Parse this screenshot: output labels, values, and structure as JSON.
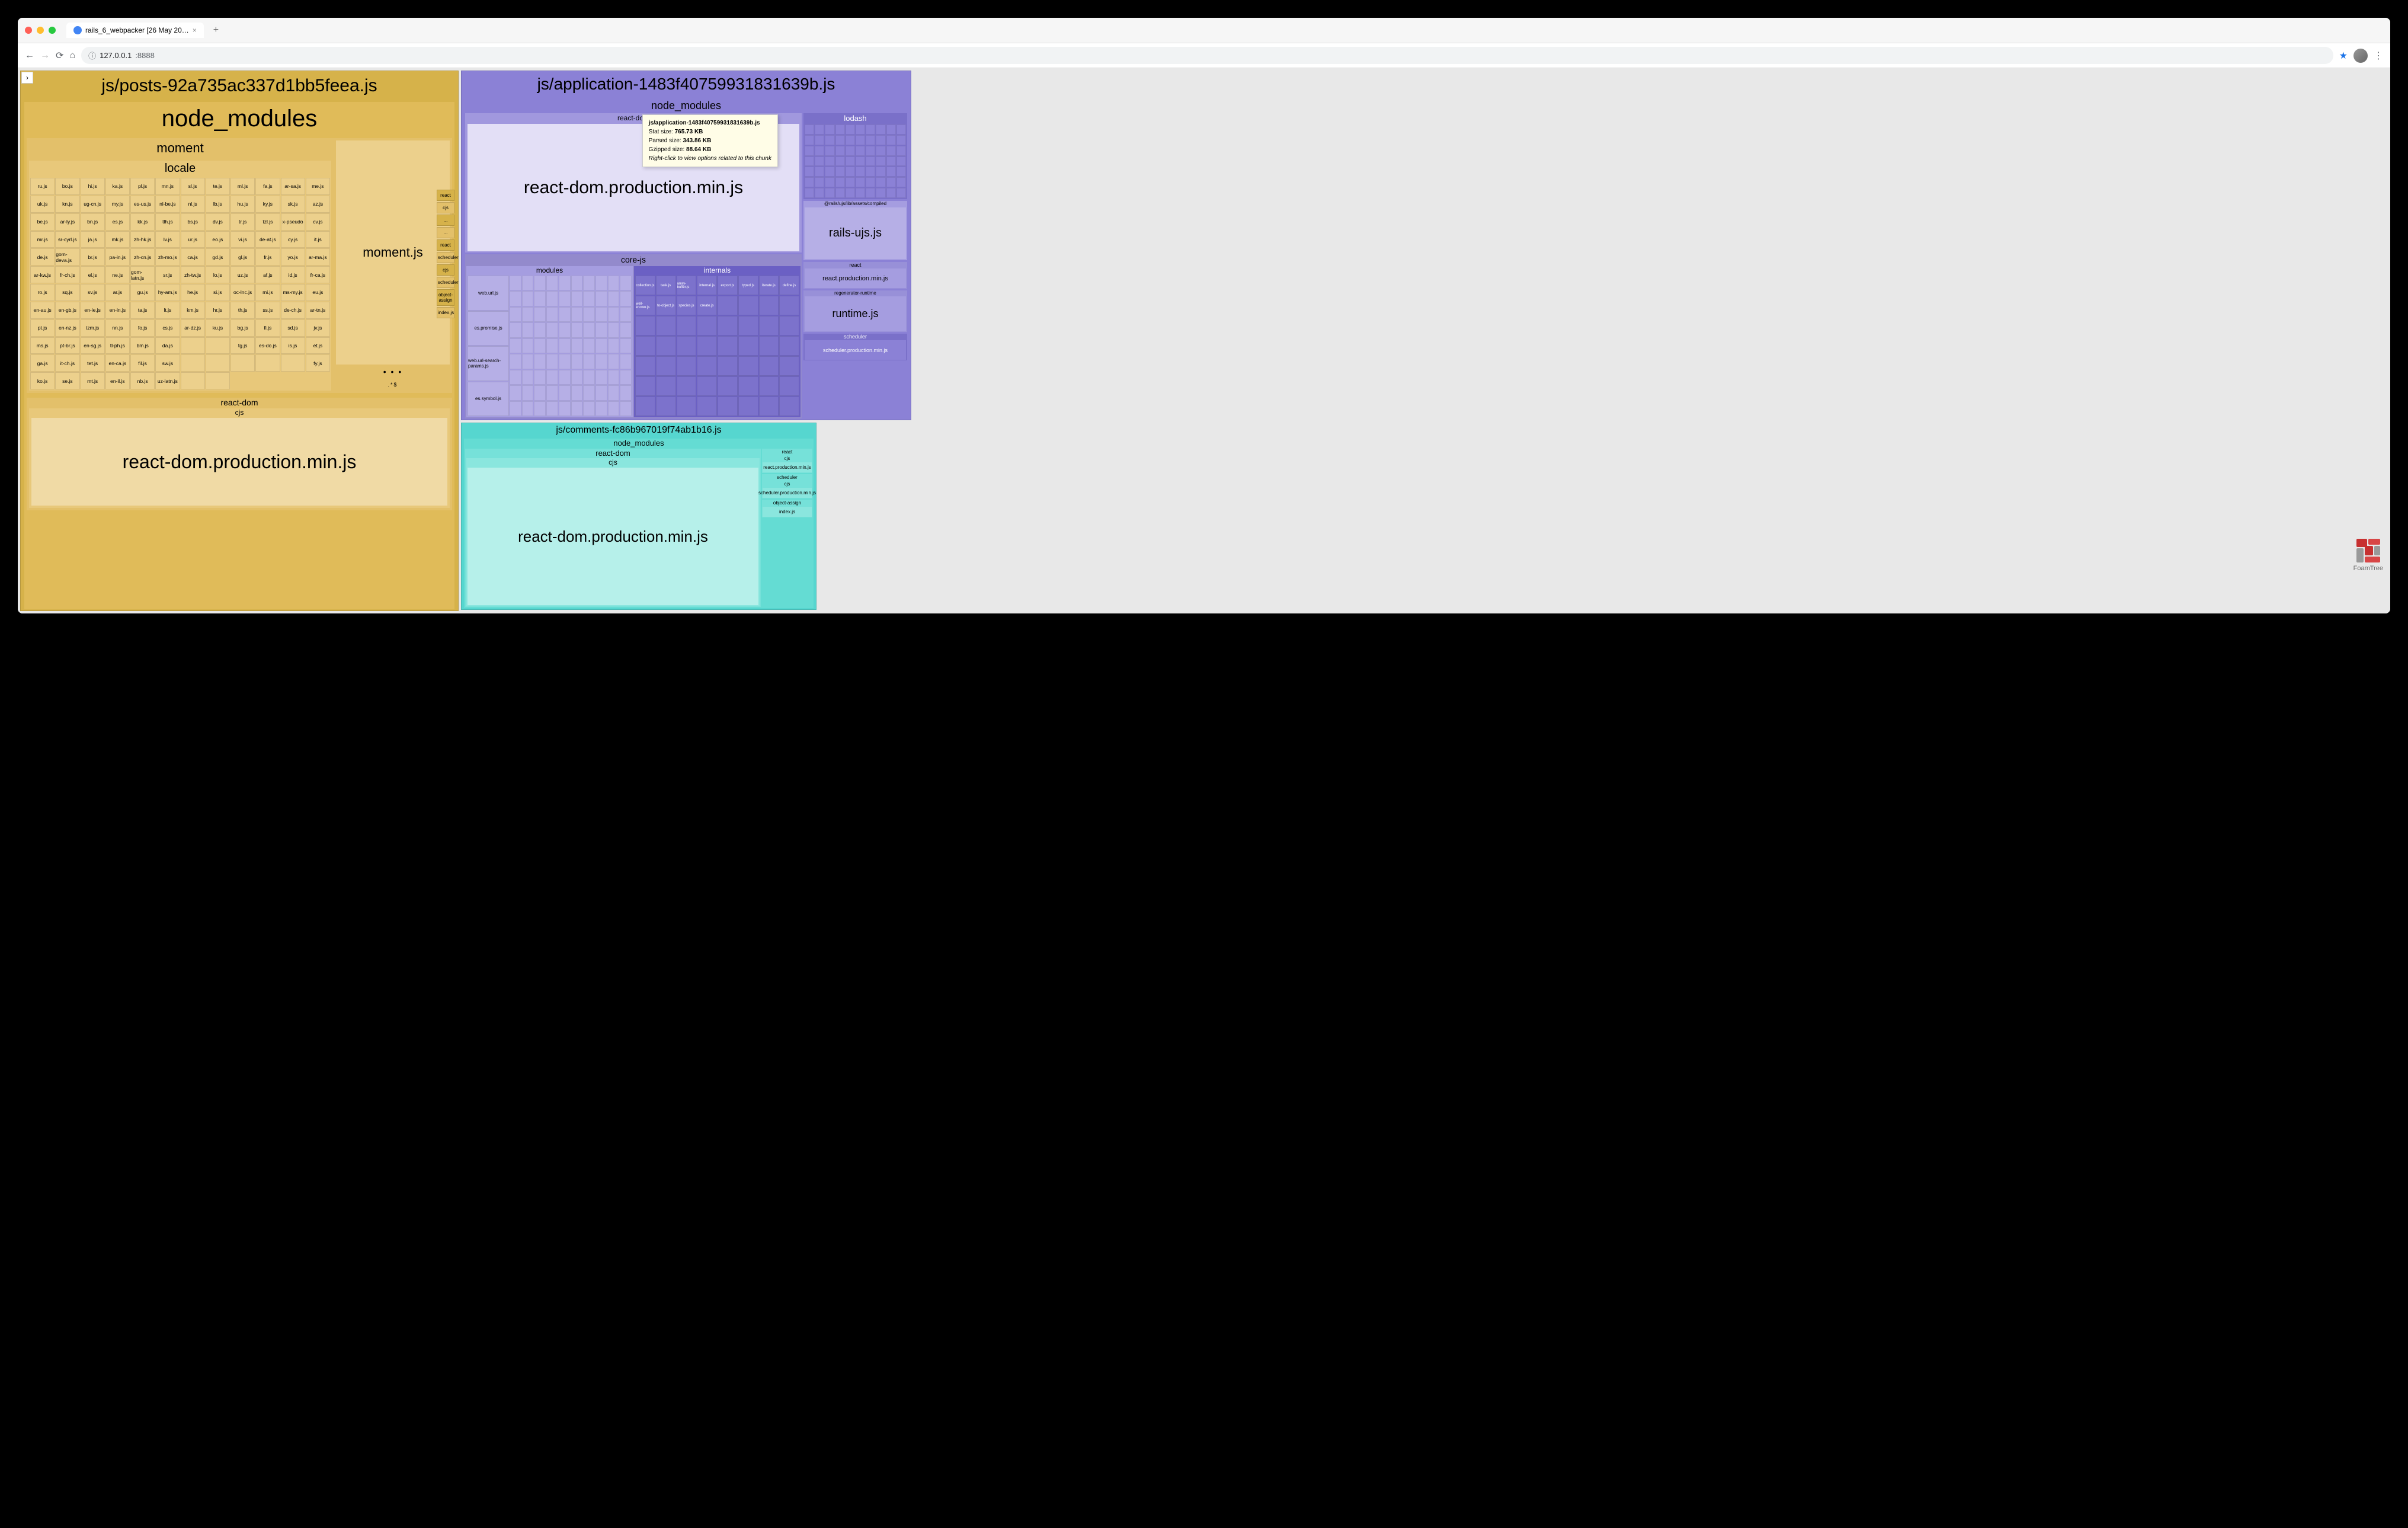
{
  "browser": {
    "tab_title": "rails_6_webpacker [26 May 20…",
    "tab_close": "×",
    "new_tab": "+",
    "nav": {
      "back": "←",
      "forward": "→",
      "reload": "⟳",
      "home": "⌂"
    },
    "url_prefix": "ⓘ",
    "url_host": "127.0.0.1",
    "url_port": ":8888",
    "star": "★",
    "menu": "⋮",
    "expand": "›"
  },
  "bundles": {
    "posts": {
      "filename": "js/posts-92a735ac337d1bb5feea.js",
      "node_modules": "node_modules",
      "moment": {
        "label": "moment",
        "locale": {
          "label": "locale"
        },
        "momentjs": "moment.js"
      },
      "react_dom": {
        "label": "react-dom",
        "cjs": "cjs",
        "file": "react-dom.production.min.js"
      },
      "side": [
        "react",
        "cjs",
        "...",
        "...",
        "react",
        "scheduler",
        "cjs",
        "scheduler",
        "object-assign",
        "index.js"
      ],
      "ellipsis": "• • •",
      "symbol_chip": ".*$"
    },
    "application": {
      "filename": "js/application-1483f40759931831639b.js",
      "node_modules": "node_modules",
      "react_dom": {
        "sub1": "react-dom",
        "file": "react-dom.production.min.js"
      },
      "corejs": {
        "label": "core-js",
        "modules": {
          "label": "modules",
          "items": [
            "web.url.js",
            "es.promise.js",
            "web.url-search-params.js",
            "es.symbol.js"
          ]
        },
        "internals": {
          "label": "internals",
          "items": [
            "collection.js",
            "task.js",
            "array-buffer.js",
            "internal.js",
            "export.js",
            "typed.js",
            "iterate.js",
            "define.js",
            "well-known.js",
            "to-object.js",
            "species.js",
            "create.js"
          ]
        }
      },
      "lodash": {
        "label": "lodash"
      },
      "rails_ujs": {
        "sub": "@rails/ujs/lib/assets/compiled",
        "file": "rails-ujs.js"
      },
      "react": {
        "sub": "react",
        "file": "react.production.min.js"
      },
      "runtime": {
        "sub": "regenerator-runtime",
        "file": "runtime.js"
      },
      "scheduler": {
        "sub": "scheduler",
        "file": "scheduler.production.min.js"
      }
    },
    "comments": {
      "filename": "js/comments-fc86b967019f74ab1b16.js",
      "node_modules": "node_modules",
      "react_dom": {
        "label": "react-dom",
        "cjs": "cjs",
        "file": "react-dom.production.min.js"
      },
      "right": [
        {
          "sub": "react",
          "sub2": "cjs",
          "inner": "react.production.min.js"
        },
        {
          "sub": "scheduler",
          "sub2": "cjs",
          "inner": "scheduler.production.min.js"
        },
        {
          "sub": "object-assign",
          "inner": "index.js"
        }
      ]
    }
  },
  "tooltip": {
    "title": "js/application-1483f40759931831639b.js",
    "stat_label": "Stat size:",
    "stat_value": "765.73 KB",
    "parsed_label": "Parsed size:",
    "parsed_value": "343.86 KB",
    "gzip_label": "Gzipped size:",
    "gzip_value": "88.64 KB",
    "hint": "Right-click to view options related to this chunk"
  },
  "locale_files": [
    "ru.js",
    "bo.js",
    "hi.js",
    "ka.js",
    "pl.js",
    "mn.js",
    "sl.js",
    "te.js",
    "ml.js",
    "fa.js",
    "ar-sa.js",
    "me.js",
    "uk.js",
    "kn.js",
    "ug-cn.js",
    "my.js",
    "es-us.js",
    "nl-be.js",
    "nl.js",
    "lb.js",
    "hu.js",
    "ky.js",
    "sk.js",
    "az.js",
    "be.js",
    "ar-ly.js",
    "bn.js",
    "es.js",
    "kk.js",
    "tlh.js",
    "bs.js",
    "dv.js",
    "tr.js",
    "tzl.js",
    "x-pseudo",
    "cv.js",
    "mr.js",
    "sr-cyrl.js",
    "ja.js",
    "mk.js",
    "zh-hk.js",
    "lv.js",
    "ur.js",
    "eo.js",
    "vi.js",
    "de-at.js",
    "cy.js",
    "it.js",
    "de.js",
    "gom-deva.js",
    "br.js",
    "pa-in.js",
    "zh-cn.js",
    "zh-mo.js",
    "ca.js",
    "gd.js",
    "gl.js",
    "fr.js",
    "yo.js",
    "ar-ma.js",
    "ar-kw.js",
    "fr-ch.js",
    "el.js",
    "ne.js",
    "gom-latn.js",
    "sr.js",
    "zh-tw.js",
    "lo.js",
    "uz.js",
    "af.js",
    "id.js",
    "fr-ca.js",
    "ro.js",
    "sq.js",
    "sv.js",
    "ar.js",
    "gu.js",
    "hy-am.js",
    "he.js",
    "si.js",
    "oc-lnc.js",
    "mi.js",
    "ms-my.js",
    "eu.js",
    "en-au.js",
    "en-gb.js",
    "en-ie.js",
    "en-in.js",
    "ta.js",
    "lt.js",
    "km.js",
    "hr.js",
    "th.js",
    "ss.js",
    "de-ch.js",
    "ar-tn.js",
    "pt.js",
    "en-nz.js",
    "tzm.js",
    "nn.js",
    "fo.js",
    "cs.js",
    "ar-dz.js",
    "ku.js",
    "bg.js",
    "fi.js",
    "sd.js",
    "jv.js",
    "ms.js",
    "pt-br.js",
    "en-sg.js",
    "tl-ph.js",
    "bm.js",
    "da.js",
    "",
    "",
    "tg.js",
    "es-do.js",
    "is.js",
    "et.js",
    "ga.js",
    "it-ch.js",
    "tet.js",
    "en-ca.js",
    "fil.js",
    "sw.js",
    "",
    "",
    "",
    "",
    "",
    "fy.js",
    "ko.js",
    "se.js",
    "mt.js",
    "en-il.js",
    "nb.js",
    "uz-latn.js",
    "",
    ""
  ],
  "foamtree": {
    "label": "FoamTree"
  }
}
